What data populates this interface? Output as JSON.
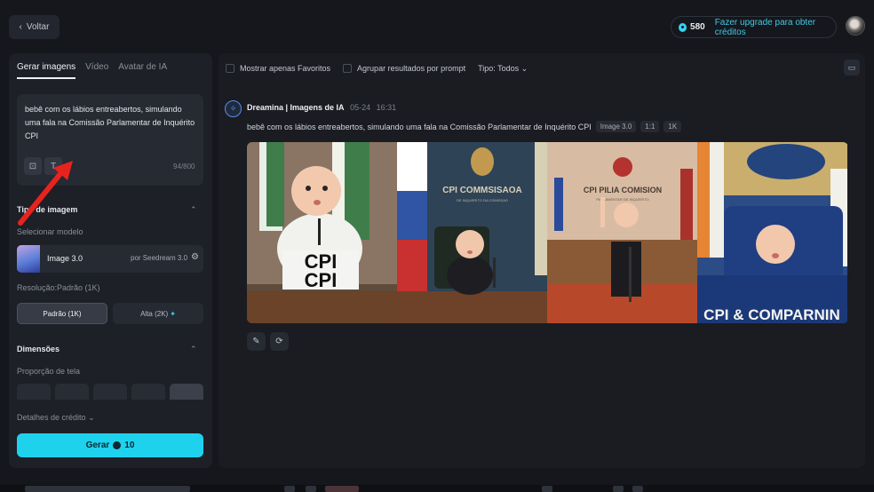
{
  "header": {
    "back_label": "Voltar",
    "credits": "580",
    "upgrade_label": "Fazer upgrade para obter créditos"
  },
  "left": {
    "tabs": [
      {
        "label": "Gerar imagens"
      },
      {
        "label": "Vídeo"
      },
      {
        "label": "Avatar de IA"
      }
    ],
    "prompt": "bebê com os lábios entreabertos, simulando uma fala na Comissão Parlamentar de Inquérito CPI",
    "char_count": "94/800",
    "image_type_title": "Tipo de imagem",
    "select_model_label": "Selecionar modelo",
    "model": {
      "name": "Image 3.0",
      "by": "por Seedream 3.0"
    },
    "resolution_label": "Resolução:Padrão (1K)",
    "resolution_options": [
      {
        "label": "Padrão (1K)",
        "selected": true
      },
      {
        "label": "Alta (2K)",
        "selected": false
      }
    ],
    "dimensions_title": "Dimensões",
    "aspect_label": "Proporção de tela",
    "credit_details": "Detalhes de crédito",
    "generate_label": "Gerar",
    "generate_cost": "10"
  },
  "right": {
    "filters": [
      {
        "label": "Mostrar apenas Favoritos"
      },
      {
        "label": "Agrupar resultados por prompt"
      }
    ],
    "type_filter": "Tipo: Todos",
    "source_name": "Dreamina | Imagens de IA",
    "source_date": "05-24",
    "source_time": "16:31",
    "prompt": "bebê com os lábios entreabertos, simulando uma fala na Comissão Parlamentar de Inquérito CPI",
    "tags": [
      "Image 3.0",
      "1:1",
      "1K"
    ],
    "images": [
      {
        "sign": "CPI",
        "sign2": "CPI"
      },
      {
        "banner": "CPI COMMSISAOA",
        "banner_small": "DE INQUERITO DA COMISSAO"
      },
      {
        "banner": "CPI PILIA COMISION",
        "banner_small": "PARLAMENTAR DE INQUERITO"
      },
      {
        "sign": "CPI & COMPARNIN"
      }
    ]
  },
  "colors": {
    "accent": "#1ed2ee",
    "panel": "#1d2027",
    "background": "#15171c"
  },
  "icons": [
    "chevron-left-icon",
    "credit-coin-icon",
    "image-upload-icon",
    "text-icon",
    "chevron-up-icon",
    "sliders-icon",
    "sparkle-icon",
    "chevron-down-icon",
    "panel-icon",
    "dreamina-logo-icon",
    "edit-icon",
    "regenerate-icon"
  ]
}
